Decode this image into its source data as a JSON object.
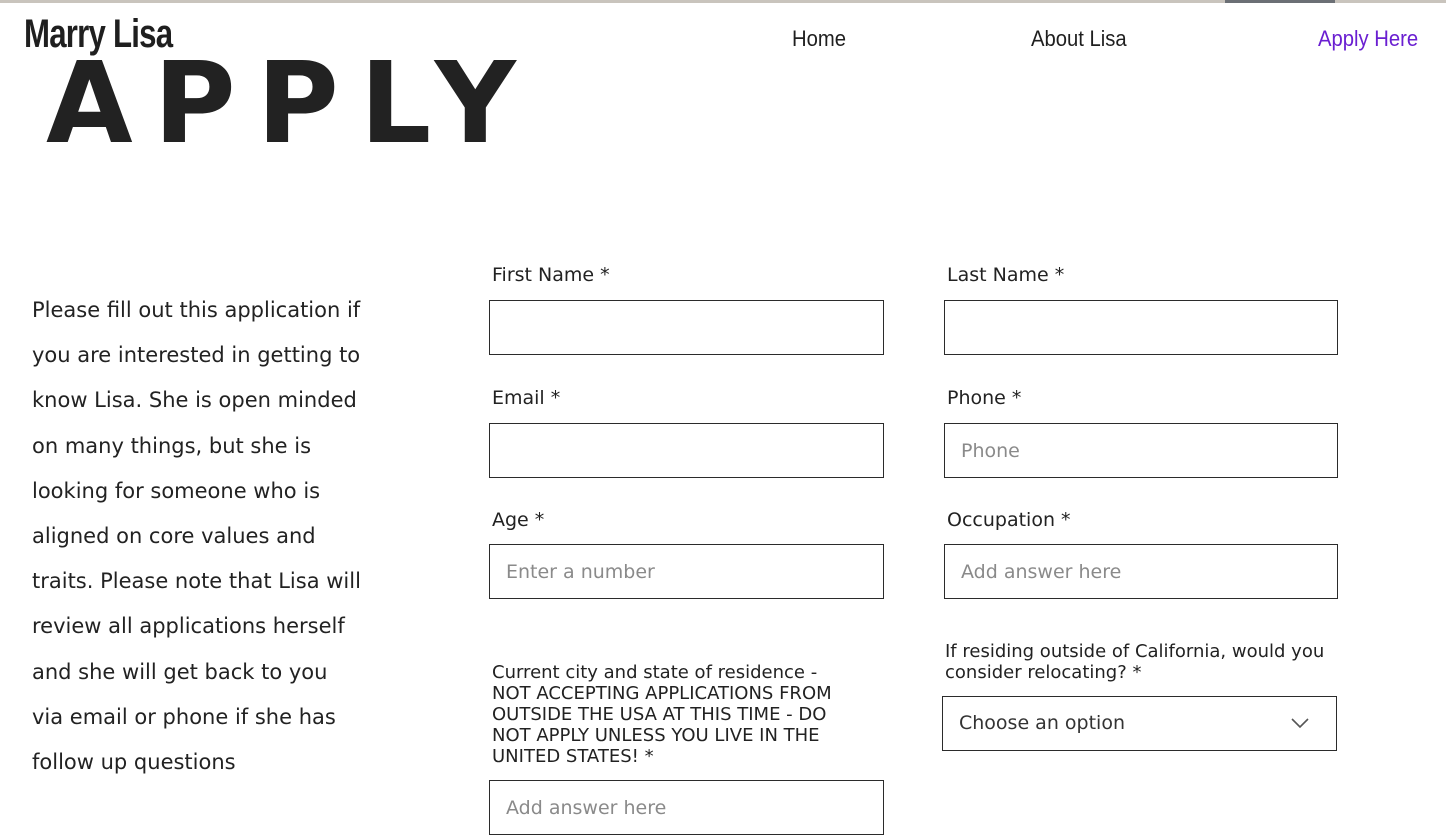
{
  "header": {
    "brand": "Marry Lisa",
    "nav": [
      {
        "label": "Home"
      },
      {
        "label": "About Lisa"
      },
      {
        "label": "Apply Here"
      }
    ]
  },
  "hero_title": "APPLY",
  "intro_text": "Please fill out this application if you are interested in getting to know Lisa. She is open minded on many things, but she is looking for someone who is aligned on core values and traits. Please note that Lisa will review all applications herself and she will get back to you via email or phone if she has follow up questions",
  "form": {
    "first_name": {
      "label": "First Name *",
      "value": "",
      "placeholder": ""
    },
    "last_name": {
      "label": "Last Name *",
      "value": "",
      "placeholder": ""
    },
    "email": {
      "label": "Email *",
      "value": "",
      "placeholder": ""
    },
    "phone": {
      "label": "Phone *",
      "value": "",
      "placeholder": "Phone"
    },
    "age": {
      "label": "Age *",
      "value": "",
      "placeholder": "Enter a number"
    },
    "occupation": {
      "label": "Occupation *",
      "value": "",
      "placeholder": "Add answer here"
    },
    "residence": {
      "label": "Current city and state of residence - NOT ACCEPTING APPLICATIONS FROM OUTSIDE THE USA AT THIS TIME - DO NOT APPLY UNLESS YOU LIVE IN THE UNITED STATES! *",
      "value": "",
      "placeholder": "Add answer here"
    },
    "relocate": {
      "label": "If residing outside of California, would you consider relocating? *",
      "selected": "Choose an option"
    }
  },
  "colors": {
    "accent": "#6a1fd1",
    "text": "#222222",
    "border": "#2b2b2b",
    "placeholder": "#8a8a8a"
  },
  "icons": {
    "dropdown": "chevron-down-icon"
  }
}
